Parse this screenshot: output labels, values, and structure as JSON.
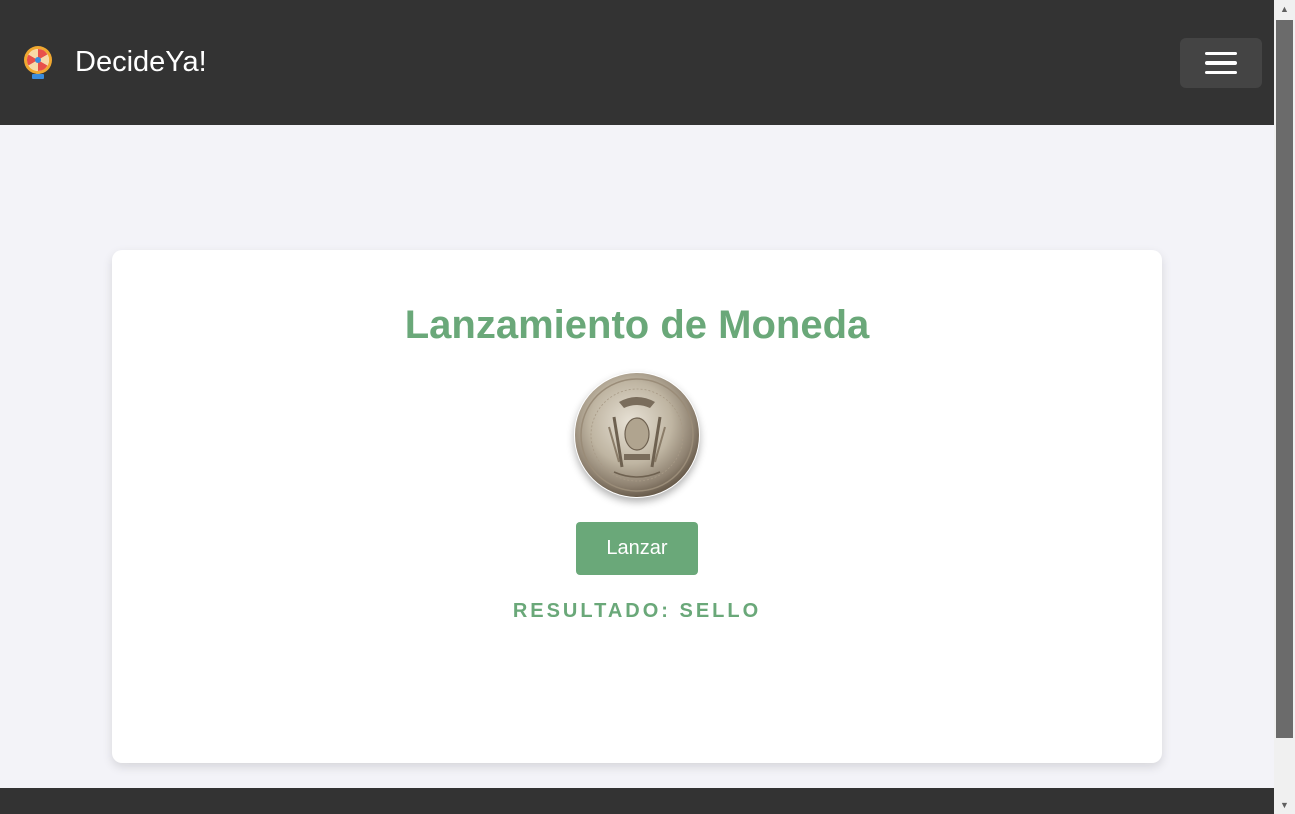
{
  "header": {
    "brand": "DecideYa!",
    "logo_icon": "wheel-of-fortune-icon",
    "menu_icon": "hamburger-menu-icon"
  },
  "main": {
    "title": "Lanzamiento de Moneda",
    "coin_icon": "coin-image",
    "toss_button": "Lanzar",
    "result": "RESULTADO: SELLO"
  },
  "colors": {
    "navbar": "#333333",
    "accent": "#6aa879",
    "background": "#f3f3f8",
    "card": "#ffffff"
  }
}
